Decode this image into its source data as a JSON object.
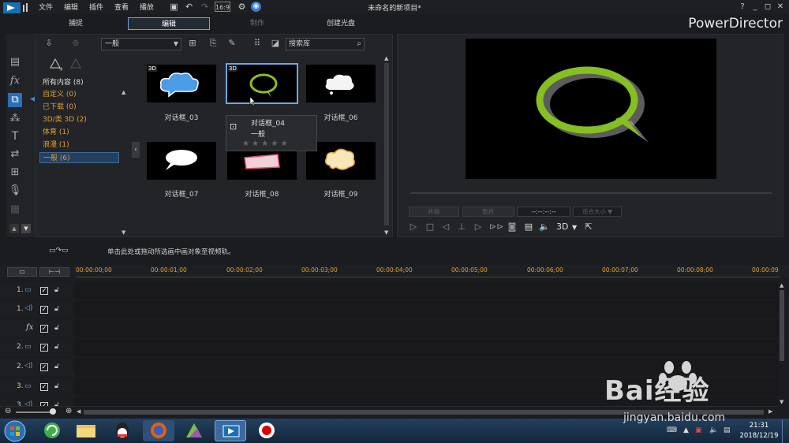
{
  "menu": {
    "file": "文件",
    "edit": "编辑",
    "plugins": "插件",
    "view": "查看",
    "play": "播放"
  },
  "title": "未命名的新项目*",
  "window": {
    "help": "?",
    "minimize": "_",
    "restore": "◻",
    "close": "✕"
  },
  "modes": {
    "capture": "捕捉",
    "edit": "编辑",
    "produce": "制作",
    "disc": "创建光盘"
  },
  "brand": "PowerDirector",
  "library": {
    "filter_selected": "一般",
    "search_placeholder": "搜索库",
    "categories": [
      {
        "label": "所有内容 (8)"
      },
      {
        "label": "自定义 (0)"
      },
      {
        "label": "已下载 (0)"
      },
      {
        "label": "3D/类 3D (2)"
      },
      {
        "label": "体育 (1)"
      },
      {
        "label": "浪漫 (1)"
      },
      {
        "label": "一般 (6)"
      }
    ],
    "items": [
      {
        "label": "对话框_03",
        "badge": "3D"
      },
      {
        "label": "对话框_04",
        "badge": "3D"
      },
      {
        "label": "对话框_06",
        "badge": ""
      },
      {
        "label": "对话框_07",
        "badge": ""
      },
      {
        "label": "对话框_08",
        "badge": ""
      },
      {
        "label": "对话框_09",
        "badge": ""
      }
    ],
    "tooltip": {
      "name": "对话框_04",
      "category": "一般",
      "stars": "★ ★ ★ ★ ★"
    }
  },
  "preview": {
    "btn_clip": "片段",
    "btn_movie": "影片",
    "timecode": "--:--:--:--",
    "fit_label": "适合大小",
    "mode_3d": "3D"
  },
  "hint": "单击此处或拖动所选画中画对象至视频轨。",
  "timeline": {
    "ruler": [
      "00:00:00;00",
      "00:00:01;00",
      "00:00:02;00",
      "00:00:03;00",
      "00:00:04;00",
      "00:00:05;00",
      "00:00:06;00",
      "00:00:07;00",
      "00:00:08;00",
      "00:00:09"
    ],
    "tracks": [
      {
        "num": "1.",
        "icon": "video"
      },
      {
        "num": "1.",
        "icon": "audio"
      },
      {
        "num": "",
        "icon": "fx"
      },
      {
        "num": "2.",
        "icon": "video"
      },
      {
        "num": "2.",
        "icon": "audio"
      },
      {
        "num": "3.",
        "icon": "video"
      },
      {
        "num": "3.",
        "icon": "audio"
      }
    ],
    "fx_label": "fx"
  },
  "taskbar": {
    "time": "21:31",
    "date": "2018/12/19"
  },
  "watermark": {
    "brand": "Bai经验",
    "url": "jingyan.baidu.com"
  },
  "colors": {
    "accent": "#6aa8e0",
    "category": "#e0a030",
    "selection": "#25405e"
  }
}
